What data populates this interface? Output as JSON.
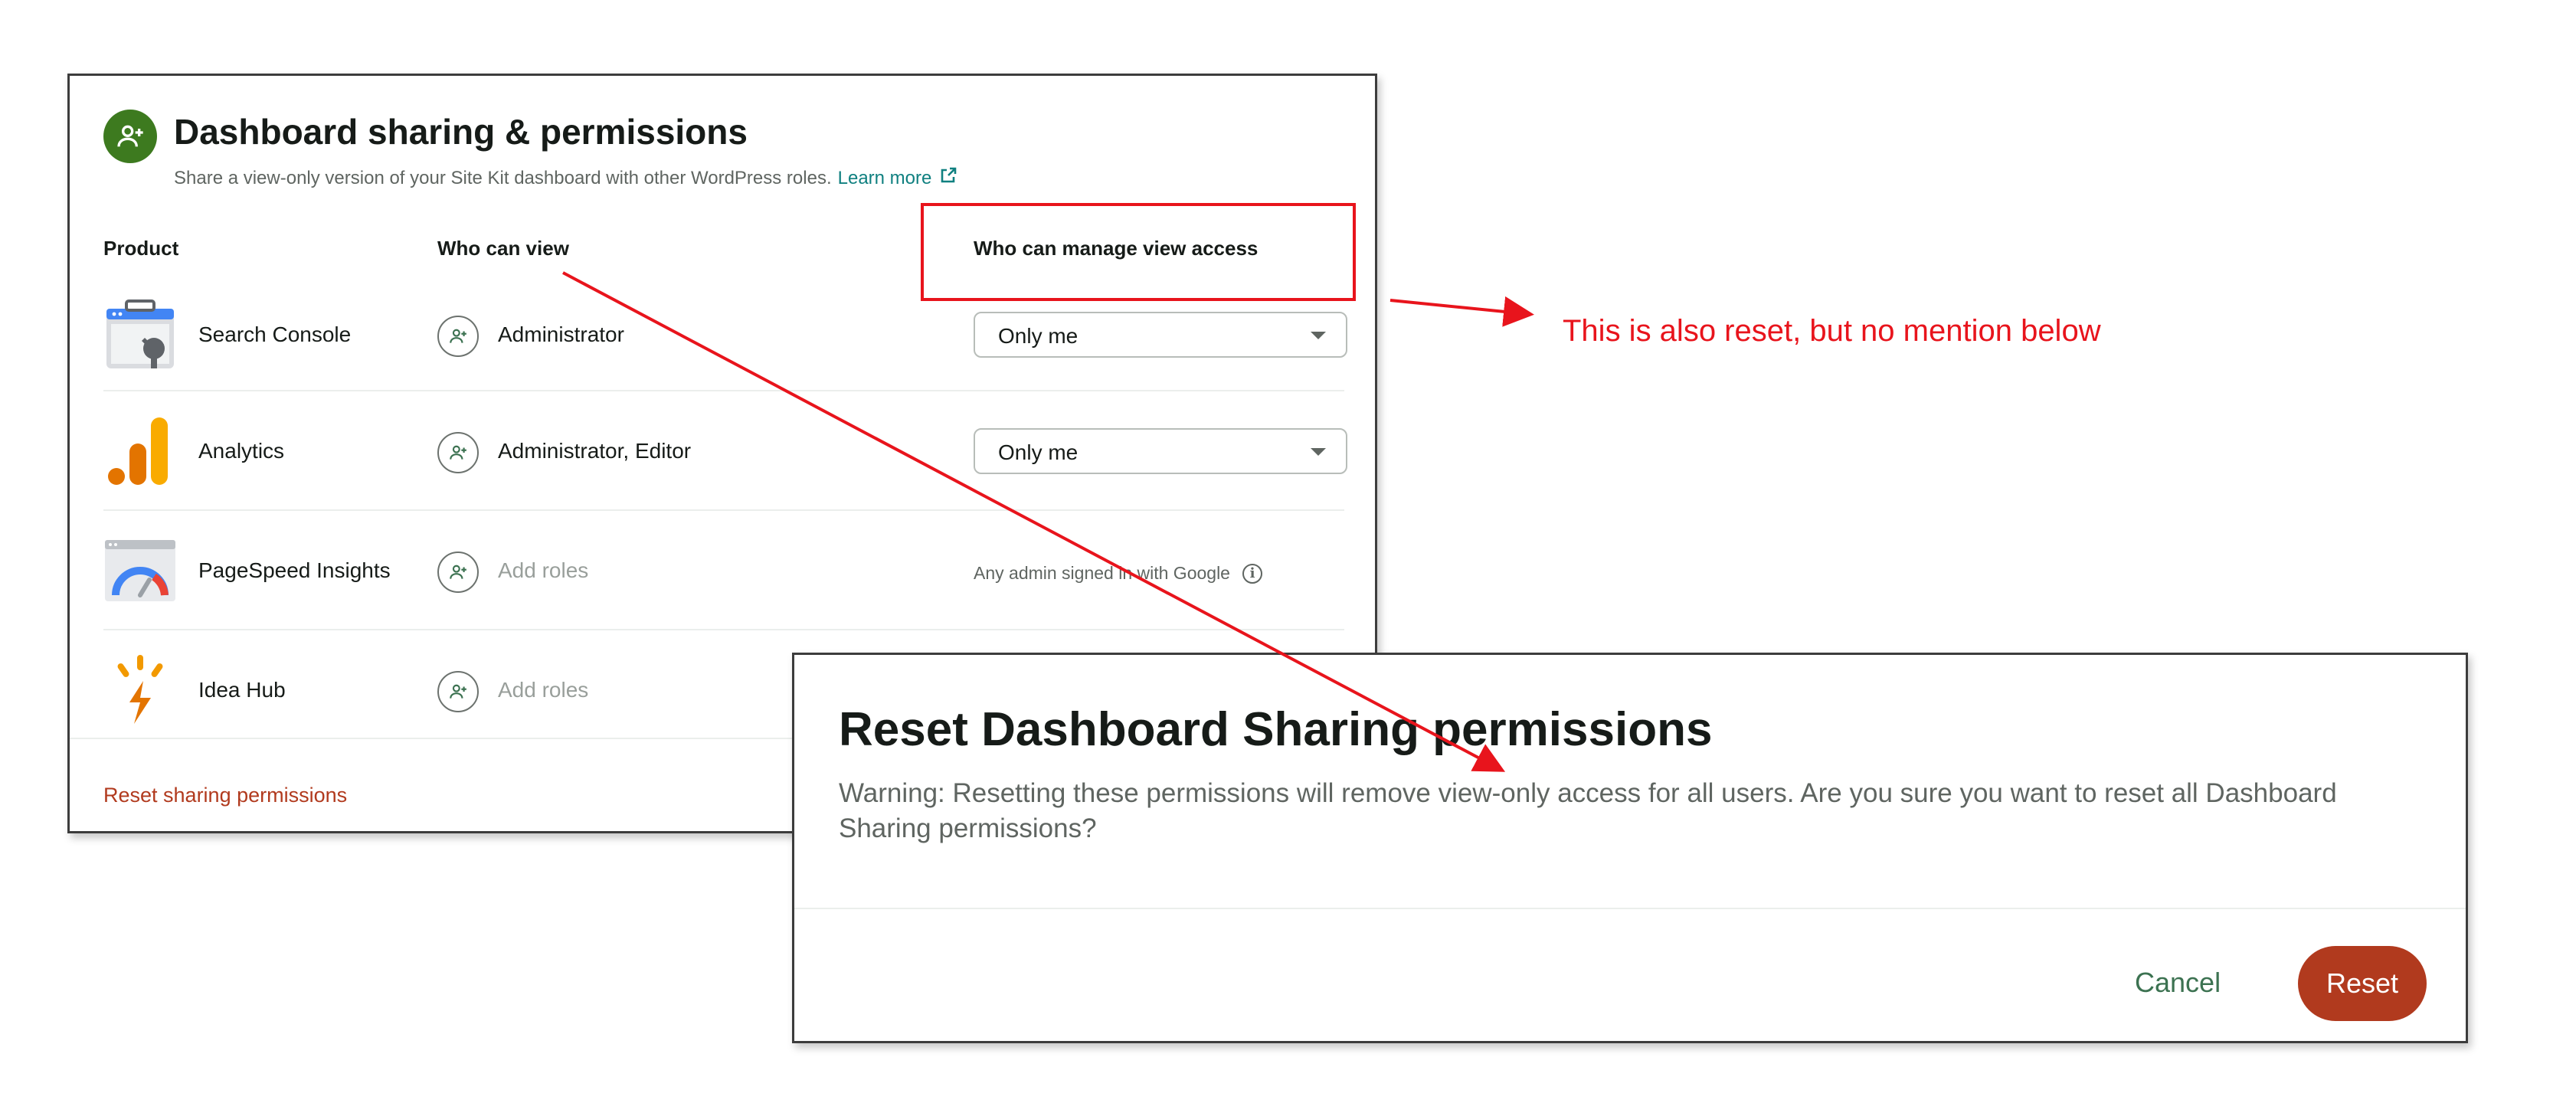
{
  "panel": {
    "title": "Dashboard sharing & permissions",
    "subtitle": "Share a view-only version of your Site Kit dashboard with other WordPress roles.",
    "learn_more": "Learn more",
    "columns": {
      "product": "Product",
      "who_can_view": "Who can view",
      "who_can_manage": "Who can manage view access"
    },
    "rows": [
      {
        "product": "Search Console",
        "icon": "search-console-icon",
        "roles": "Administrator",
        "roles_placeholder": false,
        "manage_type": "select",
        "manage_value": "Only me"
      },
      {
        "product": "Analytics",
        "icon": "analytics-icon",
        "roles": "Administrator, Editor",
        "roles_placeholder": false,
        "manage_type": "select",
        "manage_value": "Only me"
      },
      {
        "product": "PageSpeed Insights",
        "icon": "pagespeed-icon",
        "roles": "Add roles",
        "roles_placeholder": true,
        "manage_type": "text",
        "manage_value": "Any admin signed in with Google"
      },
      {
        "product": "Idea Hub",
        "icon": "idea-hub-icon",
        "roles": "Add roles",
        "roles_placeholder": true,
        "manage_type": "none",
        "manage_value": ""
      }
    ],
    "reset_link": "Reset sharing permissions",
    "accent_color": "#3d7a1f",
    "danger_color": "#b13a1e"
  },
  "dialog": {
    "title": "Reset Dashboard Sharing permissions",
    "body": "Warning: Resetting these permissions will remove view-only access for all users. Are you sure you want to reset all Dashboard Sharing permissions?",
    "cancel_label": "Cancel",
    "reset_label": "Reset"
  },
  "annotation": {
    "text": "This is also reset, but no mention below",
    "color": "#e8141c"
  }
}
